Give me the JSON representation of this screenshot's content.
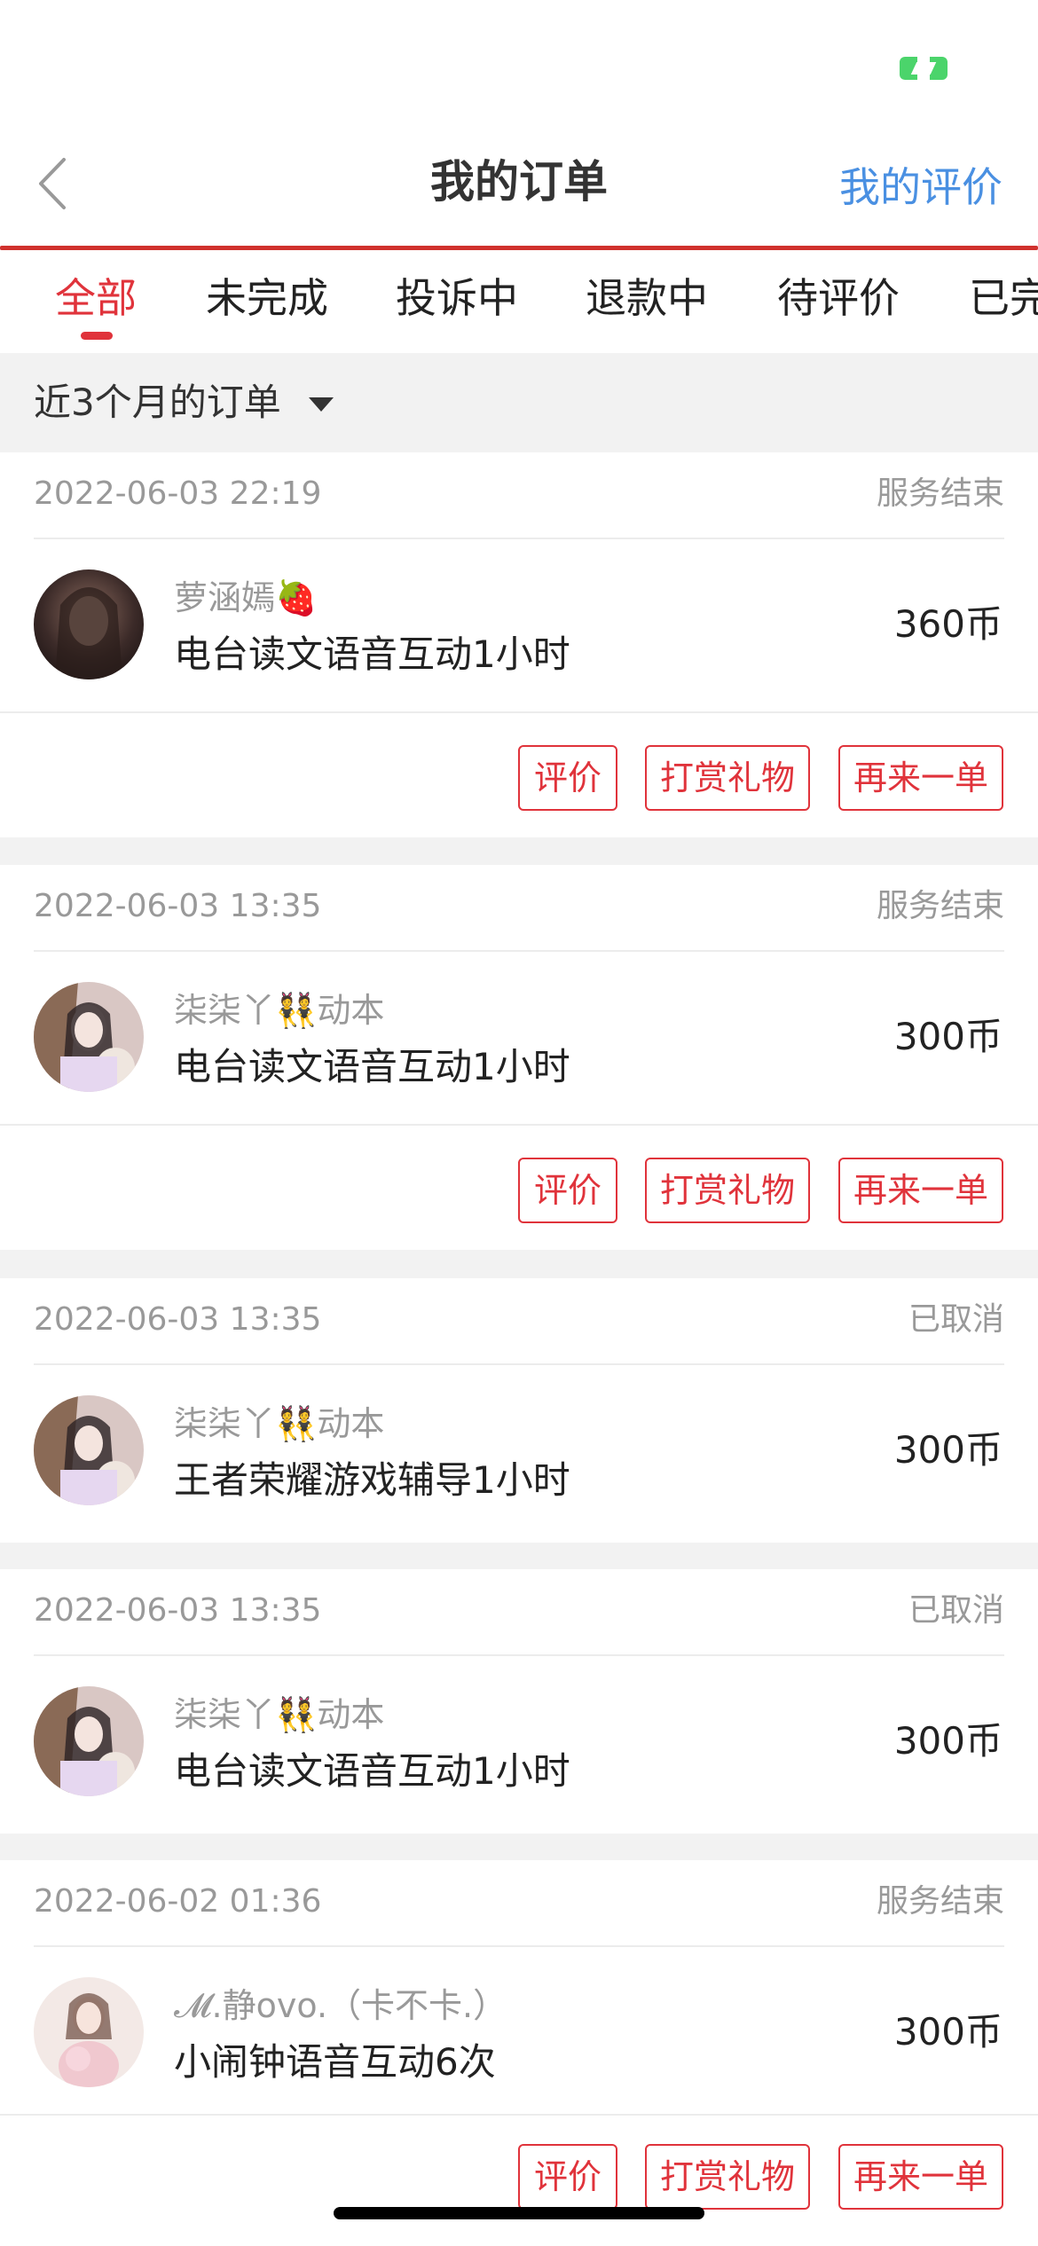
{
  "header": {
    "title": "我的订单",
    "my_review_label": "我的评价"
  },
  "tabs": [
    {
      "label": "全部",
      "active": true
    },
    {
      "label": "未完成",
      "active": false
    },
    {
      "label": "投诉中",
      "active": false
    },
    {
      "label": "退款中",
      "active": false
    },
    {
      "label": "待评价",
      "active": false
    },
    {
      "label": "已完成",
      "active": false
    }
  ],
  "filter": {
    "label": "近3个月的订单"
  },
  "orders": [
    {
      "time": "2022-06-03 22:19",
      "status": "服务结束",
      "nickname": "萝涵嫣🍓",
      "service": "电台读文语音互动1小时",
      "price": "360币",
      "buttons": [
        "评价",
        "打赏礼物",
        "再来一单"
      ]
    },
    {
      "time": "2022-06-03 13:35",
      "status": "服务结束",
      "nickname": "柒柒丫👯动本",
      "service": "电台读文语音互动1小时",
      "price": "300币",
      "buttons": [
        "评价",
        "打赏礼物",
        "再来一单"
      ]
    },
    {
      "time": "2022-06-03 13:35",
      "status": "已取消",
      "nickname": "柒柒丫👯动本",
      "service": "王者荣耀游戏辅导1小时",
      "price": "300币"
    },
    {
      "time": "2022-06-03 13:35",
      "status": "已取消",
      "nickname": "柒柒丫👯动本",
      "service": "电台读文语音互动1小时",
      "price": "300币"
    },
    {
      "time": "2022-06-02 01:36",
      "status": "服务结束",
      "nickname": "𝓜.静ovo.（卡不卡.）",
      "service": "小闹钟语音互动6次",
      "price": "300币",
      "buttons": [
        "评价",
        "打赏礼物",
        "再来一单"
      ]
    }
  ],
  "colors": {
    "accent": "#e0333b",
    "link": "#4a90e2",
    "battery": "#4bd46b"
  }
}
